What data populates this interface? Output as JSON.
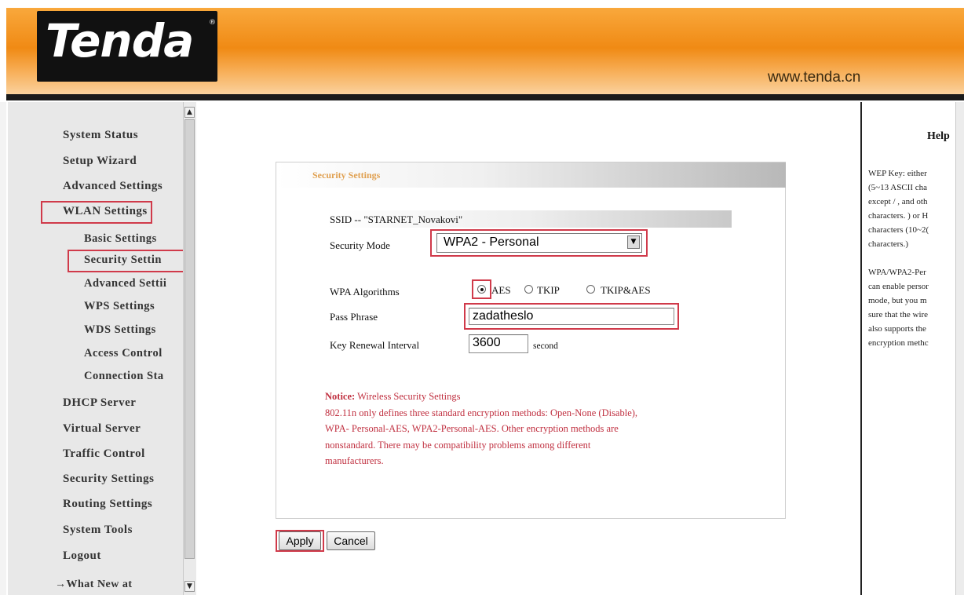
{
  "header": {
    "logo": "Tenda",
    "logo_mark": "®",
    "url": "www.tenda.cn",
    "colors": {
      "band": "#f08a14",
      "bar": "#1a1a1a"
    }
  },
  "sidebar": {
    "items": [
      {
        "label": "System Status"
      },
      {
        "label": "Setup Wizard"
      },
      {
        "label": "Advanced Settings"
      },
      {
        "label": "WLAN Settings"
      },
      {
        "label": "Basic Settings"
      },
      {
        "label": "Security Settin"
      },
      {
        "label": "Advanced Settii"
      },
      {
        "label": "WPS Settings"
      },
      {
        "label": "WDS Settings"
      },
      {
        "label": "Access Control"
      },
      {
        "label": "Connection Sta"
      },
      {
        "label": "DHCP Server"
      },
      {
        "label": "Virtual Server"
      },
      {
        "label": "Traffic Control"
      },
      {
        "label": "Security Settings"
      },
      {
        "label": "Routing Settings"
      },
      {
        "label": "System Tools"
      },
      {
        "label": "Logout"
      },
      {
        "label": "→What New at"
      }
    ],
    "highlight_color": "#d03a4a"
  },
  "panel": {
    "title": "Security Settings",
    "ssid_text": "SSID -- \"STARNET_Novakovi\"",
    "security_mode_label": "Security Mode",
    "security_mode_value": "WPA2 - Personal",
    "wpa_algorithms_label": "WPA Algorithms",
    "algo_options": [
      "AES",
      "TKIP",
      "TKIP&AES"
    ],
    "algo_selected": "AES",
    "pass_phrase_label": "Pass Phrase",
    "pass_phrase_value": "zadatheslo",
    "key_renewal_label": "Key Renewal Interval",
    "key_renewal_value": "3600",
    "key_renewal_unit": "second",
    "notice_title": "Notice:",
    "notice_subtitle": " Wireless Security Settings",
    "notice_lines": [
      "802.11n only defines three standard encryption methods: Open-None (Disable),",
      "WPA- Personal-AES, WPA2-Personal-AES. Other encryption methods are",
      "nonstandard. There may be compatibility problems among different",
      "manufacturers."
    ],
    "apply_label": "Apply",
    "cancel_label": "Cancel"
  },
  "help": {
    "title": "Help",
    "lines": [
      "WEP Key: either",
      "(5~13 ASCII cha",
      "except / , and oth",
      "characters. ) or H",
      "characters (10~2(",
      "characters.)",
      "",
      "WPA/WPA2-Per",
      "can enable persor",
      "mode, but you m",
      "sure that the wire",
      "also supports the",
      "encryption methc"
    ]
  }
}
